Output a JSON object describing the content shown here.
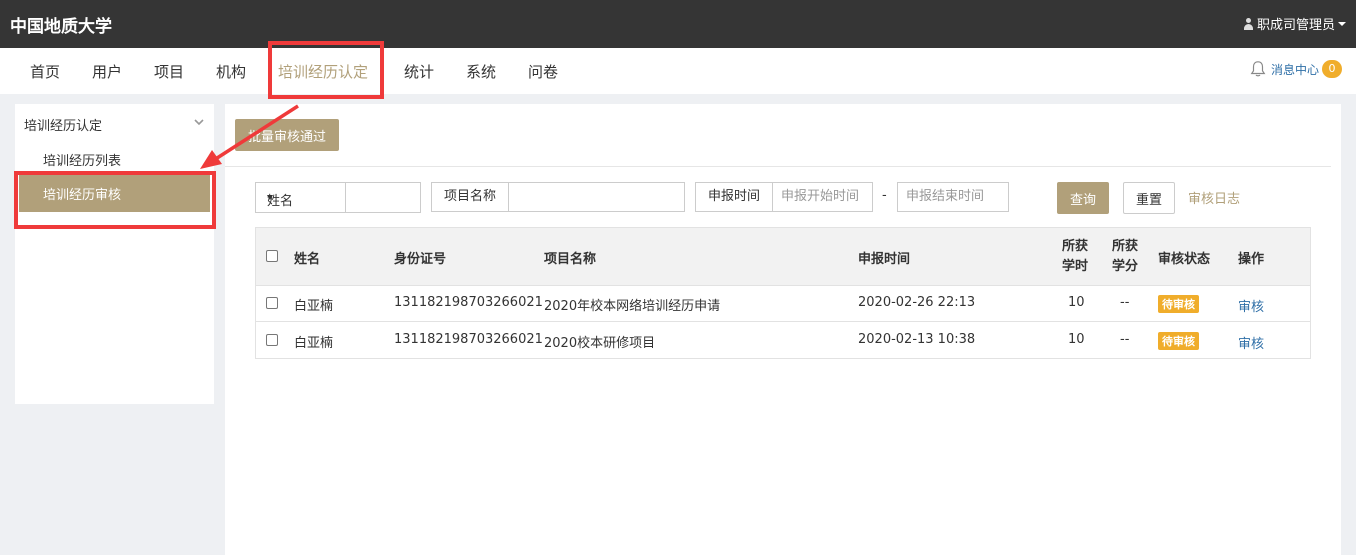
{
  "header": {
    "brand": "中国地质大学",
    "user": "职成司管理员"
  },
  "nav": {
    "items": [
      {
        "label": "首页"
      },
      {
        "label": "用户"
      },
      {
        "label": "项目"
      },
      {
        "label": "机构"
      },
      {
        "label": "培训经历认定",
        "active": true
      },
      {
        "label": "统计"
      },
      {
        "label": "系统"
      },
      {
        "label": "问卷"
      }
    ],
    "message_label": "消息中心",
    "message_count": "0"
  },
  "sidebar": {
    "title": "培训经历认定",
    "items": [
      {
        "label": "培训经历列表"
      },
      {
        "label": "培训经历审核",
        "active": true
      }
    ]
  },
  "toolbar": {
    "batch_approve_label": "批量审核通过"
  },
  "filters": {
    "name_select": "姓名",
    "project_name_label": "项目名称",
    "report_time_label": "申报时间",
    "start_placeholder": "申报开始时间",
    "separator": "-",
    "end_placeholder": "申报结束时间",
    "query_label": "查询",
    "reset_label": "重置",
    "log_label": "审核日志"
  },
  "table": {
    "headers": {
      "name": "姓名",
      "id_number": "身份证号",
      "project": "项目名称",
      "report_time": "申报时间",
      "hours_1": "所获",
      "hours_2": "学时",
      "credits_1": "所获",
      "credits_2": "学分",
      "status": "审核状态",
      "action": "操作"
    },
    "rows": [
      {
        "name": "白亚楠",
        "id_number": "131182198703266021",
        "project": "2020年校本网络培训经历申请",
        "report_time": "2020-02-26 22:13",
        "hours": "10",
        "credits": "--",
        "status": "待审核",
        "action": "审核"
      },
      {
        "name": "白亚楠",
        "id_number": "131182198703266021",
        "project": "2020校本研修项目",
        "report_time": "2020-02-13 10:38",
        "hours": "10",
        "credits": "--",
        "status": "待审核",
        "action": "审核"
      }
    ]
  },
  "colors": {
    "accent": "#b1a07a",
    "topbar": "#353535",
    "highlight": "#ef3a3a",
    "badge": "#f0ad2b",
    "link": "#2f6fa7"
  }
}
